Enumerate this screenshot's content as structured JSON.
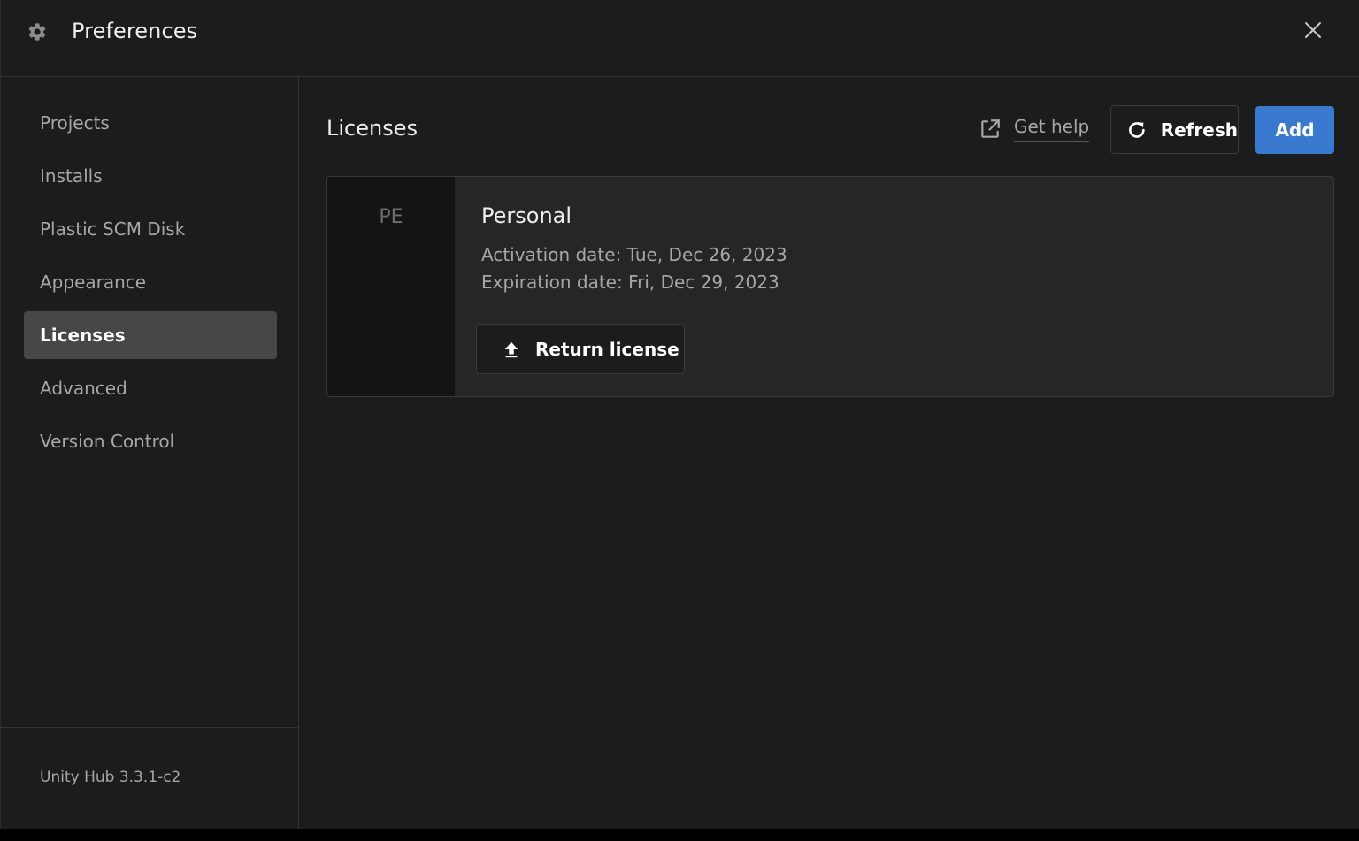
{
  "window": {
    "title": "Preferences"
  },
  "sidebar": {
    "items": [
      {
        "label": "Projects"
      },
      {
        "label": "Installs"
      },
      {
        "label": "Plastic SCM Disk"
      },
      {
        "label": "Appearance"
      },
      {
        "label": "Licenses",
        "active": true
      },
      {
        "label": "Advanced"
      },
      {
        "label": "Version Control"
      }
    ],
    "version": "Unity Hub 3.3.1-c2"
  },
  "main": {
    "title": "Licenses",
    "get_help_label": "Get help",
    "refresh_label": "Refresh",
    "add_label": "Add"
  },
  "license": {
    "badge": "PE",
    "name": "Personal",
    "activation": "Activation date: Tue, Dec 26, 2023",
    "expiration": "Expiration date: Fri, Dec 29, 2023",
    "return_label": "Return license"
  },
  "icons": {
    "title": "gear-icon",
    "close": "close-icon",
    "get_help": "external-link-icon",
    "refresh": "refresh-icon",
    "return": "upload-arrow-icon"
  },
  "colors": {
    "background": "#1c1c1c",
    "accent": "#3a79d0",
    "active_item": "#474747"
  }
}
